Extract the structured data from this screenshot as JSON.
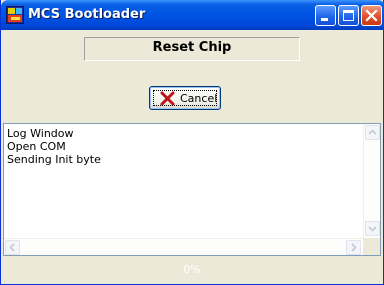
{
  "window": {
    "title": "MCS Bootloader",
    "app_icon": "mcs-app-icon",
    "controls": [
      "minimize-icon",
      "maximize-icon",
      "close-icon"
    ]
  },
  "status_panel": {
    "text": "Reset Chip"
  },
  "cancel_button": {
    "label": "Cancel",
    "icon": "red-x-icon"
  },
  "log": {
    "lines": [
      "Log Window",
      "Open COM",
      "Sending Init byte"
    ]
  },
  "progress": {
    "text": "0%",
    "value": 0
  },
  "colors": {
    "titlebar": "#0054e3",
    "window_bg": "#ece9d8",
    "cancel_x": "#c0141c"
  }
}
